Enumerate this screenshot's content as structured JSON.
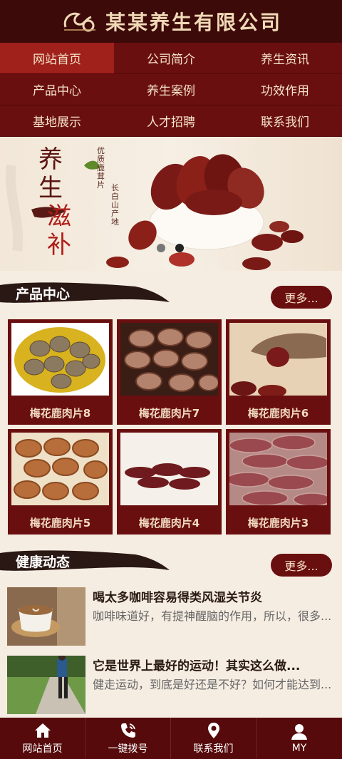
{
  "header": {
    "title": "某某养生有限公司"
  },
  "nav": {
    "items": [
      {
        "label": "网站首页"
      },
      {
        "label": "公司简介"
      },
      {
        "label": "养生资讯"
      },
      {
        "label": "产品中心"
      },
      {
        "label": "养生案例"
      },
      {
        "label": "功效作用"
      },
      {
        "label": "基地展示"
      },
      {
        "label": "人才招聘"
      },
      {
        "label": "联系我们"
      }
    ]
  },
  "banner": {
    "title_line1": "养",
    "title_line2": "生",
    "title_line3": "滋",
    "title_line4": "补",
    "vertical_text1": "优质鹿茸片",
    "vertical_text2": "长白山产地"
  },
  "products": {
    "title": "产品中心",
    "more_label": "更多...",
    "items": [
      {
        "label": "梅花鹿肉片8"
      },
      {
        "label": "梅花鹿肉片7"
      },
      {
        "label": "梅花鹿肉片6"
      },
      {
        "label": "梅花鹿肉片5"
      },
      {
        "label": "梅花鹿肉片4"
      },
      {
        "label": "梅花鹿肉片3"
      }
    ]
  },
  "news": {
    "title": "健康动态",
    "more_label": "更多...",
    "items": [
      {
        "title": "喝太多咖啡容易得类风湿关节炎",
        "summary": "咖啡味道好，有提神醒脑的作用，所以，很多..."
      },
      {
        "title": "它是世界上最好的运动！其实这么做...",
        "summary": "健走运动，到底是好还是不好？如何才能达到..."
      }
    ]
  },
  "footer": {
    "items": [
      {
        "label": "网站首页",
        "icon": "home-icon"
      },
      {
        "label": "一键拨号",
        "icon": "phone-icon"
      },
      {
        "label": "联系我们",
        "icon": "location-pin-icon"
      },
      {
        "label": "MY",
        "icon": "user-icon"
      }
    ]
  },
  "colors": {
    "primary": "#6a0f10",
    "header": "#3c0a08",
    "active": "#a0201b",
    "background": "#f6ede2"
  }
}
